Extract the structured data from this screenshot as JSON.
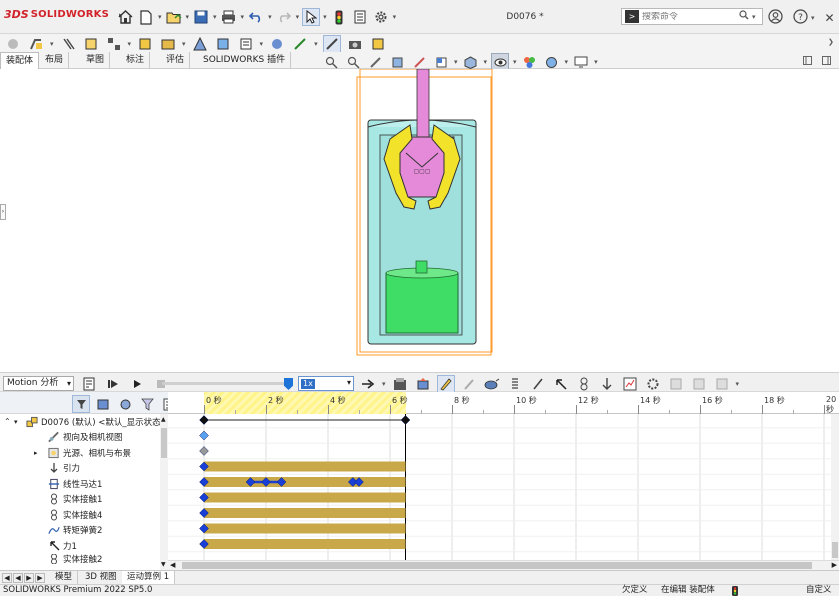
{
  "app": {
    "brand_prefix": "3DS",
    "brand_name": "SOLIDWORKS",
    "document_title": "D0076 *"
  },
  "search": {
    "placeholder": "搜索命令"
  },
  "command_manager": {
    "tabs": [
      "装配体",
      "布局",
      "草图",
      "标注",
      "评估",
      "SOLIDWORKS 插件"
    ]
  },
  "motion": {
    "study_type": "Motion 分析",
    "playback_speed": "1x"
  },
  "tree": {
    "items": [
      {
        "label": "D0076 (默认) <默认_显示状态",
        "icon": "assembly-icon"
      },
      {
        "label": "视向及相机视图",
        "icon": "camera-icon"
      },
      {
        "label": "光源、相机与布景",
        "icon": "lights-icon"
      },
      {
        "label": "引力",
        "icon": "gravity-icon"
      },
      {
        "label": "线性马达1",
        "icon": "linear-motor-icon"
      },
      {
        "label": "实体接触1",
        "icon": "contact-icon"
      },
      {
        "label": "实体接触4",
        "icon": "contact-icon"
      },
      {
        "label": "转矩弹簧2",
        "icon": "torsion-spring-icon"
      },
      {
        "label": "力1",
        "icon": "force-icon"
      },
      {
        "label": "实体接触2",
        "icon": "contact-icon"
      }
    ]
  },
  "timeline": {
    "tick_labels": [
      "0 秒",
      "2 秒",
      "4 秒",
      "6 秒",
      "8 秒",
      "10 秒",
      "12 秒",
      "14 秒",
      "16 秒",
      "18 秒",
      "20 秒"
    ],
    "tick_seconds": [
      0,
      2,
      4,
      6,
      8,
      10,
      12,
      14,
      16,
      18,
      20
    ],
    "end_time_seconds": 6.5,
    "feature_bars": [
      {
        "row": 3,
        "start": 0,
        "end": 6.5,
        "keys": []
      },
      {
        "row": 4,
        "start": 0,
        "end": 6.5,
        "keys": [
          1.5,
          2.0,
          2.5,
          4.8,
          5.0
        ]
      },
      {
        "row": 5,
        "start": 0,
        "end": 6.5,
        "keys": []
      },
      {
        "row": 6,
        "start": 0,
        "end": 6.5,
        "keys": []
      },
      {
        "row": 7,
        "start": 0,
        "end": 6.5,
        "keys": []
      },
      {
        "row": 8,
        "start": 0,
        "end": 6.5,
        "keys": []
      }
    ],
    "colors": {
      "bar": "#c9a84a",
      "key": "#1a3fd6",
      "playhead": "#000000"
    }
  },
  "bottom_tabs": {
    "items": [
      "模型",
      "3D 视图",
      "运动算例 1"
    ]
  },
  "status": {
    "version": "SOLIDWORKS Premium 2022 SP5.0",
    "definition": "欠定义",
    "editing": "在编辑 装配体",
    "custom": "自定义"
  },
  "model_colors": {
    "housing": "#a8e8e4",
    "green_part": "#3fdc66",
    "gripper": "#f2e22a",
    "rod": "#e58ad8",
    "bbox": "#ff9a2a"
  }
}
